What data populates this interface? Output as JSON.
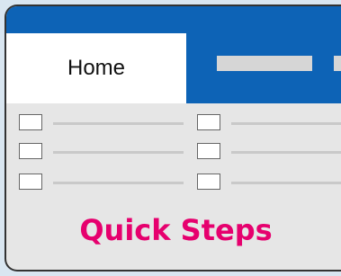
{
  "ribbon": {
    "tabs": [
      {
        "label": "Home",
        "selected": true
      }
    ],
    "accent_color": "#0d63b6",
    "tab_placeholder_color": "#d6d6d6"
  },
  "group": {
    "title": "Quick Steps",
    "title_color": "#e6006e",
    "columns": 2,
    "rows": 3
  }
}
